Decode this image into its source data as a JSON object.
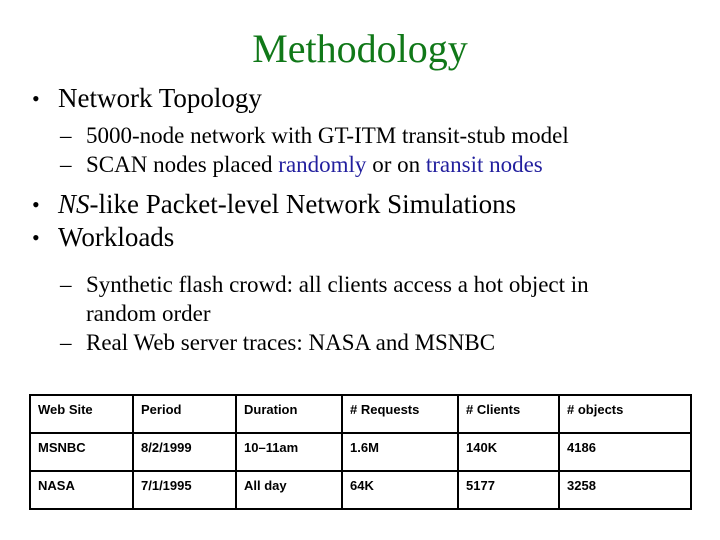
{
  "slide": {
    "title": "Methodology",
    "title_color": "#107818",
    "accent_blue": "#221F9E",
    "background": "#FFFFFF"
  },
  "bullets": {
    "marker_level1": "•",
    "marker_level2": "–",
    "items": [
      {
        "level": 1,
        "text": "Network Topology"
      },
      {
        "level": 2,
        "text": "5000-node network with GT-ITM transit-stub model"
      },
      {
        "level": 2,
        "segments": [
          {
            "text": "SCAN nodes placed ",
            "style": "plain"
          },
          {
            "text": "randomly",
            "style": "blue"
          },
          {
            "text": " or on ",
            "style": "plain"
          },
          {
            "text": "transit nodes",
            "style": "blue"
          }
        ]
      },
      {
        "level": 1,
        "segments": [
          {
            "text": "NS",
            "style": "italic"
          },
          {
            "text": "-like Packet-level Network Simulations",
            "style": "plain"
          }
        ]
      },
      {
        "level": 1,
        "text": "Workloads"
      },
      {
        "level": 2,
        "text": "Synthetic flash crowd: all clients access a hot object in",
        "continuation": "random order"
      },
      {
        "level": 2,
        "text": "Real Web server traces: NASA and MSNBC"
      }
    ]
  },
  "table": {
    "headers": [
      "Web Site",
      "Period",
      "Duration",
      "# Requests",
      "# Clients",
      "# objects"
    ],
    "rows": [
      {
        "site": "MSNBC",
        "period": "8/2/1999",
        "duration": "10–11am",
        "requests": "1.6M",
        "clients": "140K",
        "objects": "4186"
      },
      {
        "site": "NASA",
        "period": "7/1/1995",
        "duration": "All day",
        "requests": "64K",
        "clients": "5177",
        "objects": "3258"
      }
    ]
  }
}
